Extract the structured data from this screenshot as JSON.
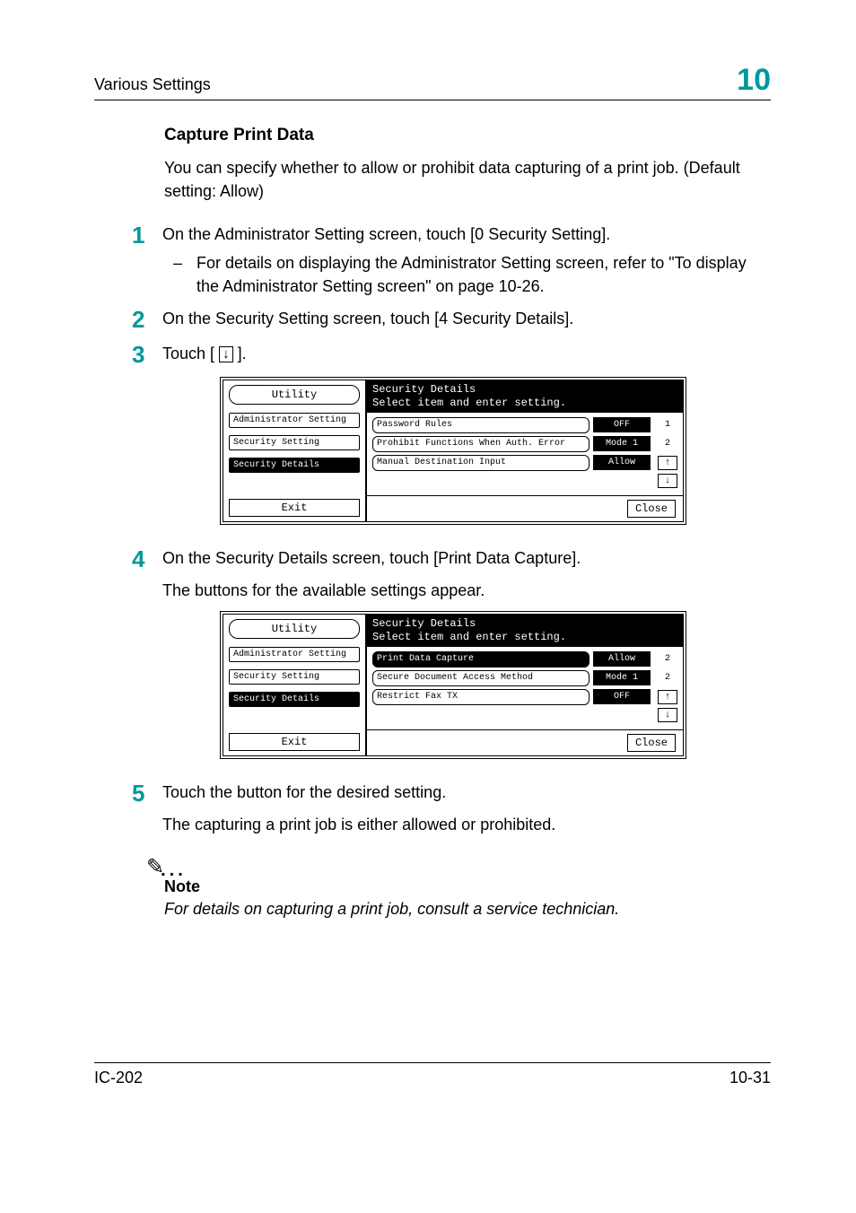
{
  "header": {
    "title": "Various Settings",
    "chapter_num": "10"
  },
  "section": {
    "heading": "Capture Print Data",
    "intro": "You can specify whether to allow or prohibit data capturing of a print job. (Default setting: Allow)"
  },
  "steps": {
    "s1": {
      "text": "On the Administrator Setting screen, touch [0 Security Setting].",
      "sub": "For details on displaying the Administrator Setting screen, refer to \"To display the Administrator Setting screen\" on page 10-26."
    },
    "s2": {
      "text": "On the Security Setting screen, touch [4 Security Details]."
    },
    "s3": {
      "prefix": "Touch [",
      "suffix": " ]."
    },
    "s4": {
      "text": "On the Security Details screen, touch [Print Data Capture].",
      "text2": "The buttons for the available settings appear."
    },
    "s5": {
      "text": "Touch the button for the desired setting.",
      "text2": "The capturing a print job is either allowed or prohibited."
    }
  },
  "panel1": {
    "title": "Utility",
    "header_line1": "Security Details",
    "header_line2": "Select item and enter setting.",
    "crumbs": [
      "Administrator Setting",
      "Security Setting",
      "Security Details"
    ],
    "crumb_selected_index": 2,
    "rows": [
      {
        "label": "Password Rules",
        "value": "OFF"
      },
      {
        "label": "Prohibit Functions When Auth. Error",
        "value": "Mode 1"
      },
      {
        "label": "Manual Destination Input",
        "value": "Allow"
      }
    ],
    "page_ind": [
      "1",
      "2"
    ],
    "exit": "Exit",
    "close": "Close"
  },
  "panel2": {
    "title": "Utility",
    "header_line1": "Security Details",
    "header_line2": "Select item and enter setting.",
    "crumbs": [
      "Administrator Setting",
      "Security Setting",
      "Security Details"
    ],
    "crumb_selected_index": 2,
    "rows": [
      {
        "label": "Print Data Capture",
        "value": "Allow",
        "label_selected": true
      },
      {
        "label": "Secure Document Access Method",
        "value": "Mode 1"
      },
      {
        "label": "Restrict Fax TX",
        "value": "OFF"
      }
    ],
    "page_ind": [
      "2",
      "2"
    ],
    "exit": "Exit",
    "close": "Close"
  },
  "note": {
    "heading": "Note",
    "text": "For details on capturing a print job, consult a service technician."
  },
  "footer": {
    "left": "IC-202",
    "right": "10-31"
  },
  "icons": {
    "down_arrow": "↓",
    "up_arrow": "↑"
  }
}
